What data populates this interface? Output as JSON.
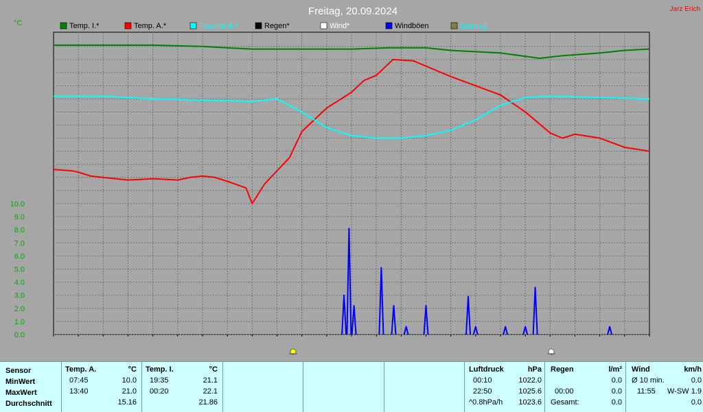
{
  "header": {
    "title": "Freitag, 20.09.2024",
    "station": "Jarz Erich",
    "unit_left": "°C"
  },
  "legend": [
    {
      "label": "Temp. I.*",
      "color": "#008000"
    },
    {
      "label": "Temp. A.*",
      "color": "#ff0000"
    },
    {
      "label": "Feuchte A.*",
      "color": "#00ffff"
    },
    {
      "label": "Regen*",
      "color": "#000000"
    },
    {
      "label": "Wind*",
      "color": "#ffffff"
    },
    {
      "label": "Windböen",
      "color": "#0000ff"
    },
    {
      "label": "Erdmag.",
      "color": "#808040"
    }
  ],
  "chart_data": {
    "type": "line",
    "title": "Freitag, 20.09.2024",
    "ylabel": "°C",
    "ylim": [
      0,
      10
    ],
    "yticks": [
      "0.0",
      "1.0",
      "2.0",
      "3.0",
      "4.0",
      "5.0",
      "6.0",
      "7.0",
      "8.0",
      "9.0",
      "10.0"
    ],
    "x_hours": [
      0,
      24
    ],
    "grid": true,
    "series": [
      {
        "name": "Temp. I.*",
        "color": "#008000",
        "points": [
          [
            0,
            22.1
          ],
          [
            2,
            22.1
          ],
          [
            4,
            22.1
          ],
          [
            6,
            22.0
          ],
          [
            7,
            21.9
          ],
          [
            8,
            21.8
          ],
          [
            10,
            21.8
          ],
          [
            12,
            21.8
          ],
          [
            13.5,
            21.9
          ],
          [
            15,
            21.9
          ],
          [
            16,
            21.7
          ],
          [
            18,
            21.5
          ],
          [
            19.58,
            21.1
          ],
          [
            20.5,
            21.3
          ],
          [
            22,
            21.5
          ],
          [
            23,
            21.7
          ],
          [
            24,
            21.8
          ]
        ]
      },
      {
        "name": "Temp. A.*",
        "color": "#ff0000",
        "points": [
          [
            0,
            12.6
          ],
          [
            0.75,
            12.5
          ],
          [
            1,
            12.4
          ],
          [
            1.5,
            12.1
          ],
          [
            2.5,
            11.9
          ],
          [
            3,
            11.8
          ],
          [
            4,
            11.9
          ],
          [
            5,
            11.8
          ],
          [
            5.5,
            12.0
          ],
          [
            6,
            12.1
          ],
          [
            6.5,
            12.0
          ],
          [
            7,
            11.7
          ],
          [
            7.75,
            11.2
          ],
          [
            8,
            10.0
          ],
          [
            8.5,
            11.5
          ],
          [
            9,
            12.5
          ],
          [
            9.5,
            13.5
          ],
          [
            10,
            15.5
          ],
          [
            11,
            17.3
          ],
          [
            12,
            18.5
          ],
          [
            12.5,
            19.4
          ],
          [
            13,
            19.8
          ],
          [
            13.67,
            21.0
          ],
          [
            14.5,
            20.9
          ],
          [
            15,
            20.5
          ],
          [
            16,
            19.7
          ],
          [
            17,
            19.0
          ],
          [
            18,
            18.3
          ],
          [
            19,
            17.0
          ],
          [
            20,
            15.4
          ],
          [
            20.5,
            15.0
          ],
          [
            21,
            15.3
          ],
          [
            22,
            15.0
          ],
          [
            23,
            14.3
          ],
          [
            24,
            14.0
          ]
        ]
      },
      {
        "name": "Feuchte A.*",
        "color": "#00ffff",
        "points": [
          [
            0,
            18.2
          ],
          [
            2,
            18.2
          ],
          [
            4,
            18.0
          ],
          [
            6,
            17.9
          ],
          [
            8,
            17.8
          ],
          [
            9,
            18.0
          ],
          [
            10,
            17.0
          ],
          [
            11,
            15.8
          ],
          [
            12,
            15.2
          ],
          [
            13,
            15.0
          ],
          [
            14,
            15.0
          ],
          [
            15,
            15.2
          ],
          [
            16,
            15.6
          ],
          [
            17,
            16.4
          ],
          [
            18,
            17.5
          ],
          [
            19,
            18.1
          ],
          [
            20,
            18.2
          ],
          [
            22,
            18.1
          ],
          [
            24,
            18.0
          ]
        ]
      },
      {
        "name": "Windböen",
        "color": "#0000ff",
        "points": [
          [
            11.7,
            3.0
          ],
          [
            11.9,
            8.1
          ],
          [
            12.1,
            2.2
          ],
          [
            13.2,
            5.1
          ],
          [
            13.7,
            2.2
          ],
          [
            14.2,
            0.6
          ],
          [
            15,
            2.2
          ],
          [
            16.7,
            2.9
          ],
          [
            17,
            0.6
          ],
          [
            18.2,
            0.6
          ],
          [
            19,
            0.6
          ],
          [
            19.4,
            3.6
          ],
          [
            22.4,
            0.6
          ]
        ]
      }
    ]
  },
  "stats": {
    "sensor": {
      "title": "Sensor",
      "rows": [
        "MinWert",
        "MaxWert",
        "Durchschnitt"
      ]
    },
    "temp_a": {
      "title": "Temp. A.",
      "unit": "°C",
      "min_time": "07:45",
      "min_val": "10.0",
      "max_time": "13:40",
      "max_val": "21.0",
      "avg": "15.16"
    },
    "temp_i": {
      "title": "Temp. I.",
      "unit": "°C",
      "min_time": "19:35",
      "min_val": "21.1",
      "max_time": "00:20",
      "max_val": "22.1",
      "avg": "21.86"
    },
    "pressure": {
      "title": "Luftdruck",
      "unit": "hPa",
      "r1_time": "00:10",
      "r1_val": "1022.0",
      "r2_time": "22:50",
      "r2_val": "1025.6",
      "r3_time": "^0.8hPa/h",
      "r3_val": "1023.6"
    },
    "rain": {
      "title": "Regen",
      "unit": "l/m²",
      "r1_val": "0.0",
      "r2_time": "00:00",
      "r2_val": "0.0",
      "r3_label": "Gesamt:",
      "r3_val": "0.0"
    },
    "wind": {
      "title": "Wind",
      "unit": "km/h",
      "r1_label": "Ø 10 min.",
      "r1_val": "0.0",
      "r2_time": "11:55",
      "r2_dir": "W-SW",
      "r2_val": "1.9",
      "r3_val": "0.0"
    }
  }
}
